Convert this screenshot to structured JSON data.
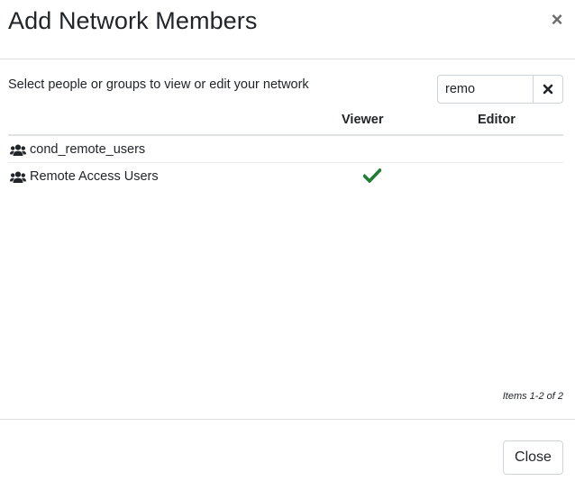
{
  "dialog": {
    "title": "Add Network Members",
    "close_symbol": "×"
  },
  "body": {
    "instruction": "Select people or groups to view or edit your network",
    "search": {
      "value": "remo",
      "placeholder": ""
    },
    "clear_icon": "times-icon",
    "table": {
      "columns": [
        "",
        "Viewer",
        "Editor"
      ],
      "rows": [
        {
          "icon": "users-icon",
          "name": "cond_remote_users",
          "viewer": false,
          "editor": false
        },
        {
          "icon": "users-icon",
          "name": "Remote Access Users",
          "viewer": true,
          "editor": false
        }
      ]
    },
    "items_info": "Items 1-2 of 2"
  },
  "footer": {
    "close_label": "Close"
  },
  "colors": {
    "check": "#1e7e34",
    "border": "#dee2e6",
    "text": "#212529"
  }
}
